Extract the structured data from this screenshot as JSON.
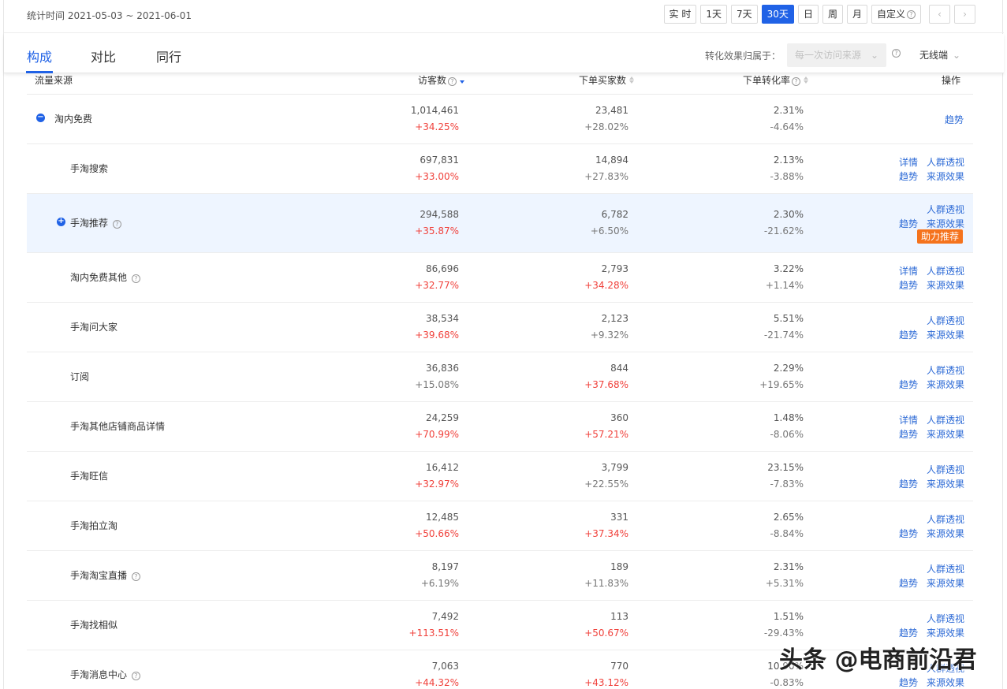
{
  "header": {
    "date_range": "统计时间 2021-05-03 ~ 2021-06-01",
    "time_buttons": [
      "实 时",
      "1天",
      "7天",
      "30天",
      "日",
      "周",
      "月",
      "自定义"
    ],
    "active_button": "30天",
    "prev_icon": "chevron-left-icon",
    "next_icon": "chevron-right-icon"
  },
  "tabs": [
    "构成",
    "对比",
    "同行"
  ],
  "active_tab": "构成",
  "attribution": {
    "label": "转化效果归属于：",
    "select_value": "每一次访问来源",
    "device": "无线端"
  },
  "columns": {
    "source": "流量来源",
    "visitors": "访客数",
    "buyers": "下单买家数",
    "conversion": "下单转化率",
    "action": "操作"
  },
  "rows": [
    {
      "name": "淘内免费",
      "visitors": "1,014,461",
      "visitors_chg": "+34.25%",
      "buyers": "23,481",
      "buyers_chg": "+28.02%",
      "conv": "2.31%",
      "conv_chg": "-4.64%",
      "links": {
        "trend": "趋势"
      }
    },
    {
      "name": "手淘搜索",
      "visitors": "697,831",
      "visitors_chg": "+33.00%",
      "buyers": "14,894",
      "buyers_chg": "+27.83%",
      "conv": "2.13%",
      "conv_chg": "-3.88%",
      "links": {
        "detail": "详情",
        "crowd": "人群透视",
        "trend": "趋势",
        "effect": "来源效果"
      }
    },
    {
      "name": "手淘推荐",
      "visitors": "294,588",
      "visitors_chg": "+35.87%",
      "buyers": "6,782",
      "buyers_chg": "+6.50%",
      "conv": "2.30%",
      "conv_chg": "-21.62%",
      "links": {
        "crowd": "人群透视",
        "trend": "趋势",
        "effect": "来源效果",
        "promo": "助力推荐"
      }
    },
    {
      "name": "淘内免费其他",
      "visitors": "86,696",
      "visitors_chg": "+32.77%",
      "buyers": "2,793",
      "buyers_chg": "+34.28%",
      "conv": "3.22%",
      "conv_chg": "+1.14%",
      "links": {
        "detail": "详情",
        "crowd": "人群透视",
        "trend": "趋势",
        "effect": "来源效果"
      }
    },
    {
      "name": "手淘问大家",
      "visitors": "38,534",
      "visitors_chg": "+39.68%",
      "buyers": "2,123",
      "buyers_chg": "+9.32%",
      "conv": "5.51%",
      "conv_chg": "-21.74%",
      "links": {
        "crowd": "人群透视",
        "trend": "趋势",
        "effect": "来源效果"
      }
    },
    {
      "name": "订阅",
      "visitors": "36,836",
      "visitors_chg": "+15.08%",
      "buyers": "844",
      "buyers_chg": "+37.68%",
      "conv": "2.29%",
      "conv_chg": "+19.65%",
      "links": {
        "crowd": "人群透视",
        "trend": "趋势",
        "effect": "来源效果"
      }
    },
    {
      "name": "手淘其他店铺商品详情",
      "visitors": "24,259",
      "visitors_chg": "+70.99%",
      "buyers": "360",
      "buyers_chg": "+57.21%",
      "conv": "1.48%",
      "conv_chg": "-8.06%",
      "links": {
        "detail": "详情",
        "crowd": "人群透视",
        "trend": "趋势",
        "effect": "来源效果"
      }
    },
    {
      "name": "手淘旺信",
      "visitors": "16,412",
      "visitors_chg": "+32.97%",
      "buyers": "3,799",
      "buyers_chg": "+22.55%",
      "conv": "23.15%",
      "conv_chg": "-7.83%",
      "links": {
        "crowd": "人群透视",
        "trend": "趋势",
        "effect": "来源效果"
      }
    },
    {
      "name": "手淘拍立淘",
      "visitors": "12,485",
      "visitors_chg": "+50.66%",
      "buyers": "331",
      "buyers_chg": "+37.34%",
      "conv": "2.65%",
      "conv_chg": "-8.84%",
      "links": {
        "crowd": "人群透视",
        "trend": "趋势",
        "effect": "来源效果"
      }
    },
    {
      "name": "手淘淘宝直播",
      "visitors": "8,197",
      "visitors_chg": "+6.19%",
      "buyers": "189",
      "buyers_chg": "+11.83%",
      "conv": "2.31%",
      "conv_chg": "+5.31%",
      "links": {
        "crowd": "人群透视",
        "trend": "趋势",
        "effect": "来源效果"
      }
    },
    {
      "name": "手淘找相似",
      "visitors": "7,492",
      "visitors_chg": "+113.51%",
      "buyers": "113",
      "buyers_chg": "+50.67%",
      "conv": "1.51%",
      "conv_chg": "-29.43%",
      "links": {
        "crowd": "人群透视",
        "trend": "趋势",
        "effect": "来源效果"
      }
    },
    {
      "name": "手淘消息中心",
      "visitors": "7,063",
      "visitors_chg": "+44.32%",
      "buyers": "770",
      "buyers_chg": "+43.12%",
      "conv": "10.90%",
      "conv_chg": "-0.83%",
      "links": {
        "crowd": "人群透视",
        "trend": "趋势",
        "effect": "来源效果"
      }
    }
  ],
  "watermark": "头条 @电商前沿君",
  "colors": {
    "accent": "#2062e6",
    "increase": "#f0413b",
    "promo": "#f5731d",
    "link": "#2e6bd6",
    "highlight_row": "#eef5ff"
  }
}
